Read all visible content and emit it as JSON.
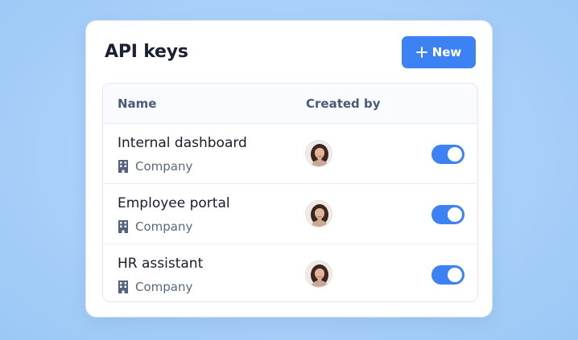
{
  "card": {
    "title": "API keys",
    "new_button": {
      "label": "New",
      "icon": "plus-icon"
    }
  },
  "table": {
    "columns": [
      "Name",
      "Created by"
    ],
    "rows": [
      {
        "name": "Internal dashboard",
        "scope": "Company",
        "scope_icon": "building-icon",
        "created_by_avatar": "avatar",
        "enabled": true
      },
      {
        "name": "Employee portal",
        "scope": "Company",
        "scope_icon": "building-icon",
        "created_by_avatar": "avatar",
        "enabled": true
      },
      {
        "name": "HR assistant",
        "scope": "Company",
        "scope_icon": "building-icon",
        "created_by_avatar": "avatar",
        "enabled": true
      }
    ]
  },
  "colors": {
    "accent": "#3d82f5",
    "background": "#a6cff9",
    "card": "#ffffff"
  }
}
